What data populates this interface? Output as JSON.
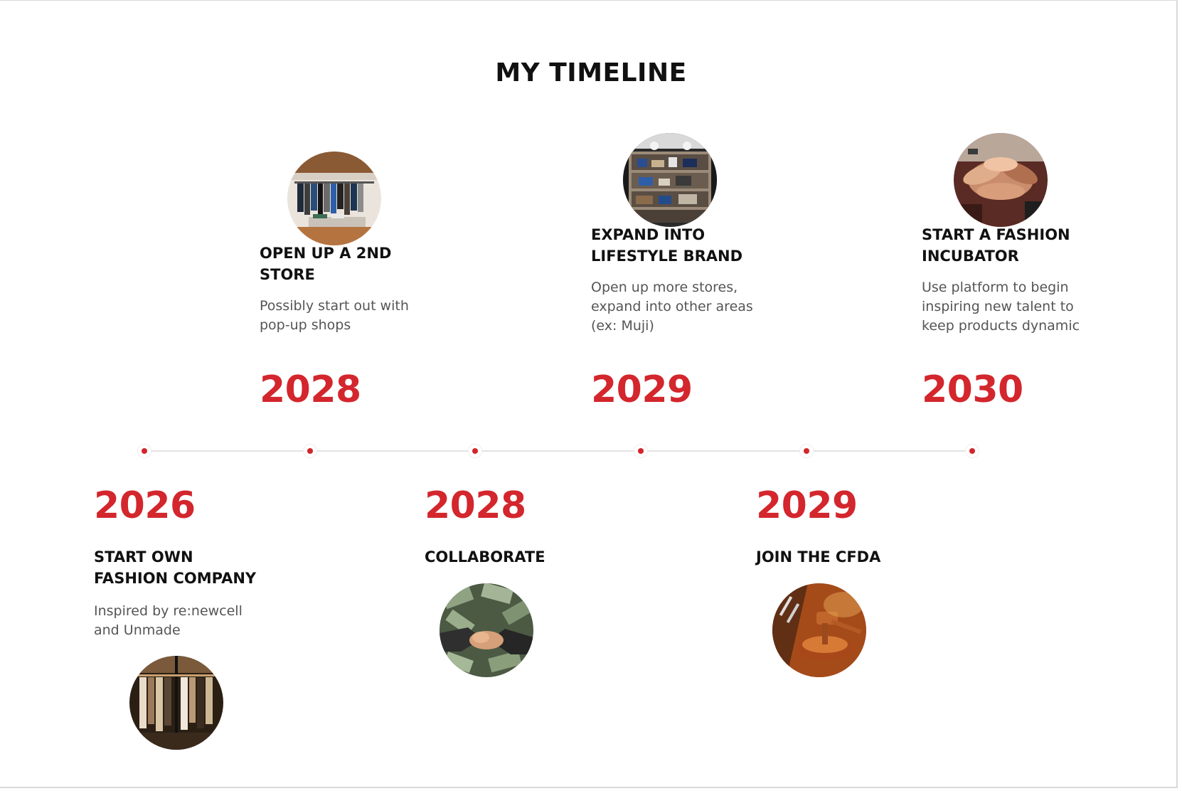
{
  "title": "MY TIMELINE",
  "accent_color": "#d3262d",
  "events_top": [
    {
      "year": "2028",
      "heading": "OPEN UP A 2ND\nSTORE",
      "description": "Possibly start out with\npop-up shops",
      "image": "clothing-store-interior-photo"
    },
    {
      "year": "2029",
      "heading": "EXPAND INTO\nLIFESTYLE BRAND",
      "description": "Open up more stores,\nexpand into other areas\n(ex: Muji)",
      "image": "lifestyle-shelves-photo"
    },
    {
      "year": "2030",
      "heading": "START A FASHION\nINCUBATOR",
      "description": "Use platform to begin\ninspiring new talent to\nkeep products dynamic",
      "image": "stacked-hands-photo"
    }
  ],
  "events_bottom": [
    {
      "year": "2026",
      "heading": "START OWN\nFASHION COMPANY",
      "description": "Inspired by re:newcell\nand Unmade",
      "image": "clothing-rack-photo"
    },
    {
      "year": "2028",
      "heading": "COLLABORATE",
      "description": "",
      "image": "handshake-money-photo"
    },
    {
      "year": "2029",
      "heading": "JOIN THE CFDA",
      "description": "",
      "image": "gavel-photo"
    }
  ]
}
